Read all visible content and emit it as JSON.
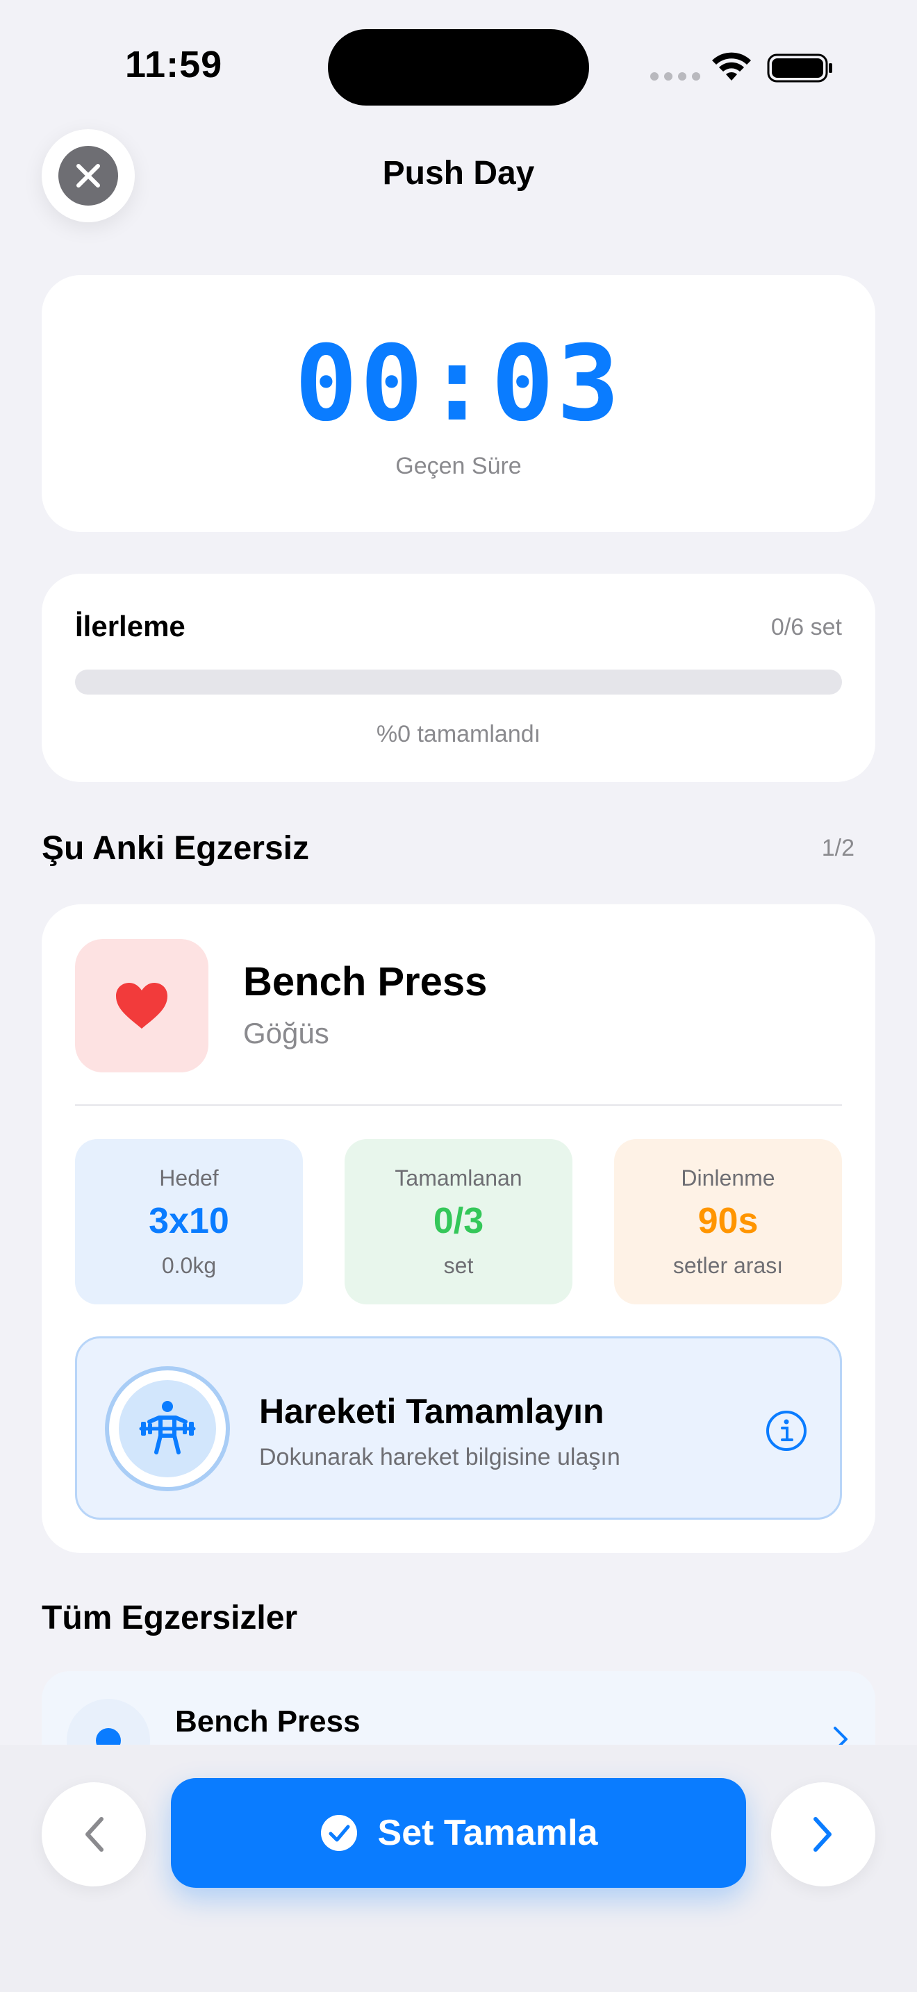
{
  "status_bar": {
    "time": "11:59"
  },
  "header": {
    "title": "Push Day"
  },
  "timer": {
    "value": "00:03",
    "label": "Geçen Süre"
  },
  "progress": {
    "title": "İlerleme",
    "count": "0/6 set",
    "fraction": 0,
    "percent_text": "%0 tamamlandı"
  },
  "current_section": {
    "title": "Şu Anki Egzersiz",
    "count": "1/2"
  },
  "current_exercise": {
    "name": "Bench Press",
    "muscle": "Göğüs",
    "icon": "heart-icon",
    "stats": {
      "target": {
        "label": "Hedef",
        "value": "3x10",
        "unit": "0.0kg"
      },
      "completed": {
        "label": "Tamamlanan",
        "value": "0/3",
        "unit": "set"
      },
      "rest": {
        "label": "Dinlenme",
        "value": "90s",
        "unit": "setler arası"
      }
    },
    "banner": {
      "title": "Hareketi Tamamlayın",
      "subtitle": "Dokunarak hareket bilgisine ulaşın",
      "icon": "weightlifter-icon"
    }
  },
  "all_section": {
    "title": "Tüm Egzersizler",
    "items": [
      {
        "name": "Bench Press"
      }
    ]
  },
  "bottom": {
    "primary_label": "Set Tamamla"
  },
  "colors": {
    "accent": "#0a7cff",
    "success": "#34c759",
    "warning": "#ff9500",
    "heart": "#f23b3b"
  }
}
